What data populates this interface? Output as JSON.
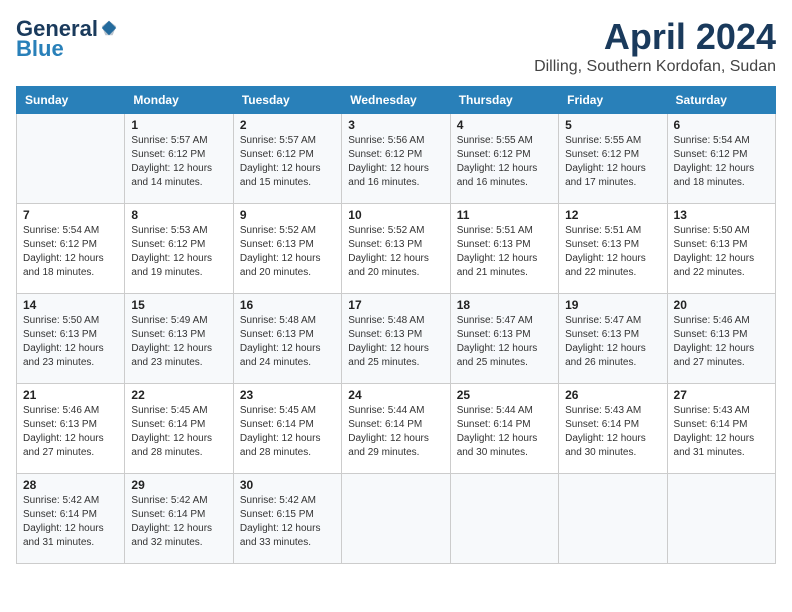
{
  "header": {
    "logo_general": "General",
    "logo_blue": "Blue",
    "month_title": "April 2024",
    "location": "Dilling, Southern Kordofan, Sudan"
  },
  "days_of_week": [
    "Sunday",
    "Monday",
    "Tuesday",
    "Wednesday",
    "Thursday",
    "Friday",
    "Saturday"
  ],
  "weeks": [
    [
      {
        "day": "",
        "sunrise": "",
        "sunset": "",
        "daylight": ""
      },
      {
        "day": "1",
        "sunrise": "Sunrise: 5:57 AM",
        "sunset": "Sunset: 6:12 PM",
        "daylight": "Daylight: 12 hours and 14 minutes."
      },
      {
        "day": "2",
        "sunrise": "Sunrise: 5:57 AM",
        "sunset": "Sunset: 6:12 PM",
        "daylight": "Daylight: 12 hours and 15 minutes."
      },
      {
        "day": "3",
        "sunrise": "Sunrise: 5:56 AM",
        "sunset": "Sunset: 6:12 PM",
        "daylight": "Daylight: 12 hours and 16 minutes."
      },
      {
        "day": "4",
        "sunrise": "Sunrise: 5:55 AM",
        "sunset": "Sunset: 6:12 PM",
        "daylight": "Daylight: 12 hours and 16 minutes."
      },
      {
        "day": "5",
        "sunrise": "Sunrise: 5:55 AM",
        "sunset": "Sunset: 6:12 PM",
        "daylight": "Daylight: 12 hours and 17 minutes."
      },
      {
        "day": "6",
        "sunrise": "Sunrise: 5:54 AM",
        "sunset": "Sunset: 6:12 PM",
        "daylight": "Daylight: 12 hours and 18 minutes."
      }
    ],
    [
      {
        "day": "7",
        "sunrise": "Sunrise: 5:54 AM",
        "sunset": "Sunset: 6:12 PM",
        "daylight": "Daylight: 12 hours and 18 minutes."
      },
      {
        "day": "8",
        "sunrise": "Sunrise: 5:53 AM",
        "sunset": "Sunset: 6:12 PM",
        "daylight": "Daylight: 12 hours and 19 minutes."
      },
      {
        "day": "9",
        "sunrise": "Sunrise: 5:52 AM",
        "sunset": "Sunset: 6:13 PM",
        "daylight": "Daylight: 12 hours and 20 minutes."
      },
      {
        "day": "10",
        "sunrise": "Sunrise: 5:52 AM",
        "sunset": "Sunset: 6:13 PM",
        "daylight": "Daylight: 12 hours and 20 minutes."
      },
      {
        "day": "11",
        "sunrise": "Sunrise: 5:51 AM",
        "sunset": "Sunset: 6:13 PM",
        "daylight": "Daylight: 12 hours and 21 minutes."
      },
      {
        "day": "12",
        "sunrise": "Sunrise: 5:51 AM",
        "sunset": "Sunset: 6:13 PM",
        "daylight": "Daylight: 12 hours and 22 minutes."
      },
      {
        "day": "13",
        "sunrise": "Sunrise: 5:50 AM",
        "sunset": "Sunset: 6:13 PM",
        "daylight": "Daylight: 12 hours and 22 minutes."
      }
    ],
    [
      {
        "day": "14",
        "sunrise": "Sunrise: 5:50 AM",
        "sunset": "Sunset: 6:13 PM",
        "daylight": "Daylight: 12 hours and 23 minutes."
      },
      {
        "day": "15",
        "sunrise": "Sunrise: 5:49 AM",
        "sunset": "Sunset: 6:13 PM",
        "daylight": "Daylight: 12 hours and 23 minutes."
      },
      {
        "day": "16",
        "sunrise": "Sunrise: 5:48 AM",
        "sunset": "Sunset: 6:13 PM",
        "daylight": "Daylight: 12 hours and 24 minutes."
      },
      {
        "day": "17",
        "sunrise": "Sunrise: 5:48 AM",
        "sunset": "Sunset: 6:13 PM",
        "daylight": "Daylight: 12 hours and 25 minutes."
      },
      {
        "day": "18",
        "sunrise": "Sunrise: 5:47 AM",
        "sunset": "Sunset: 6:13 PM",
        "daylight": "Daylight: 12 hours and 25 minutes."
      },
      {
        "day": "19",
        "sunrise": "Sunrise: 5:47 AM",
        "sunset": "Sunset: 6:13 PM",
        "daylight": "Daylight: 12 hours and 26 minutes."
      },
      {
        "day": "20",
        "sunrise": "Sunrise: 5:46 AM",
        "sunset": "Sunset: 6:13 PM",
        "daylight": "Daylight: 12 hours and 27 minutes."
      }
    ],
    [
      {
        "day": "21",
        "sunrise": "Sunrise: 5:46 AM",
        "sunset": "Sunset: 6:13 PM",
        "daylight": "Daylight: 12 hours and 27 minutes."
      },
      {
        "day": "22",
        "sunrise": "Sunrise: 5:45 AM",
        "sunset": "Sunset: 6:14 PM",
        "daylight": "Daylight: 12 hours and 28 minutes."
      },
      {
        "day": "23",
        "sunrise": "Sunrise: 5:45 AM",
        "sunset": "Sunset: 6:14 PM",
        "daylight": "Daylight: 12 hours and 28 minutes."
      },
      {
        "day": "24",
        "sunrise": "Sunrise: 5:44 AM",
        "sunset": "Sunset: 6:14 PM",
        "daylight": "Daylight: 12 hours and 29 minutes."
      },
      {
        "day": "25",
        "sunrise": "Sunrise: 5:44 AM",
        "sunset": "Sunset: 6:14 PM",
        "daylight": "Daylight: 12 hours and 30 minutes."
      },
      {
        "day": "26",
        "sunrise": "Sunrise: 5:43 AM",
        "sunset": "Sunset: 6:14 PM",
        "daylight": "Daylight: 12 hours and 30 minutes."
      },
      {
        "day": "27",
        "sunrise": "Sunrise: 5:43 AM",
        "sunset": "Sunset: 6:14 PM",
        "daylight": "Daylight: 12 hours and 31 minutes."
      }
    ],
    [
      {
        "day": "28",
        "sunrise": "Sunrise: 5:42 AM",
        "sunset": "Sunset: 6:14 PM",
        "daylight": "Daylight: 12 hours and 31 minutes."
      },
      {
        "day": "29",
        "sunrise": "Sunrise: 5:42 AM",
        "sunset": "Sunset: 6:14 PM",
        "daylight": "Daylight: 12 hours and 32 minutes."
      },
      {
        "day": "30",
        "sunrise": "Sunrise: 5:42 AM",
        "sunset": "Sunset: 6:15 PM",
        "daylight": "Daylight: 12 hours and 33 minutes."
      },
      {
        "day": "",
        "sunrise": "",
        "sunset": "",
        "daylight": ""
      },
      {
        "day": "",
        "sunrise": "",
        "sunset": "",
        "daylight": ""
      },
      {
        "day": "",
        "sunrise": "",
        "sunset": "",
        "daylight": ""
      },
      {
        "day": "",
        "sunrise": "",
        "sunset": "",
        "daylight": ""
      }
    ]
  ]
}
